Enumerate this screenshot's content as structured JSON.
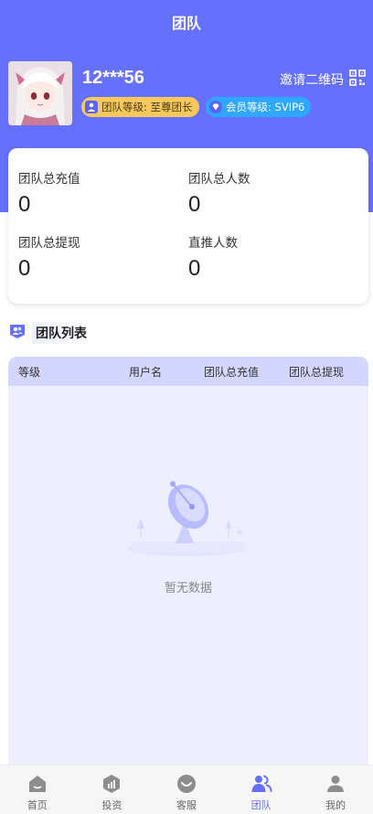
{
  "header": {
    "title": "团队"
  },
  "user": {
    "username": "12***56",
    "invite_label": "邀请二维码",
    "team_level": "团队等级: 至尊团长",
    "member_level": "会员等级: SVIP6"
  },
  "stats": {
    "team_recharge_label": "团队总充值",
    "team_recharge_value": "0",
    "team_size_label": "团队总人数",
    "team_size_value": "0",
    "team_withdraw_label": "团队总提现",
    "team_withdraw_value": "0",
    "direct_label": "直推人数",
    "direct_value": "0"
  },
  "team_list": {
    "title": "团队列表",
    "columns": [
      "等级",
      "用户名",
      "团队总充值",
      "团队总提现"
    ],
    "empty_text": "暂无数据"
  },
  "tabbar": {
    "items": [
      {
        "label": "首页",
        "icon": "home-icon"
      },
      {
        "label": "投资",
        "icon": "invest-icon"
      },
      {
        "label": "客服",
        "icon": "service-icon"
      },
      {
        "label": "团队",
        "icon": "team-icon"
      },
      {
        "label": "我的",
        "icon": "user-icon"
      }
    ]
  },
  "colors": {
    "primary": "#6670ff",
    "gold": "#f7c95a",
    "vip_blue": "#2ea7ff"
  }
}
